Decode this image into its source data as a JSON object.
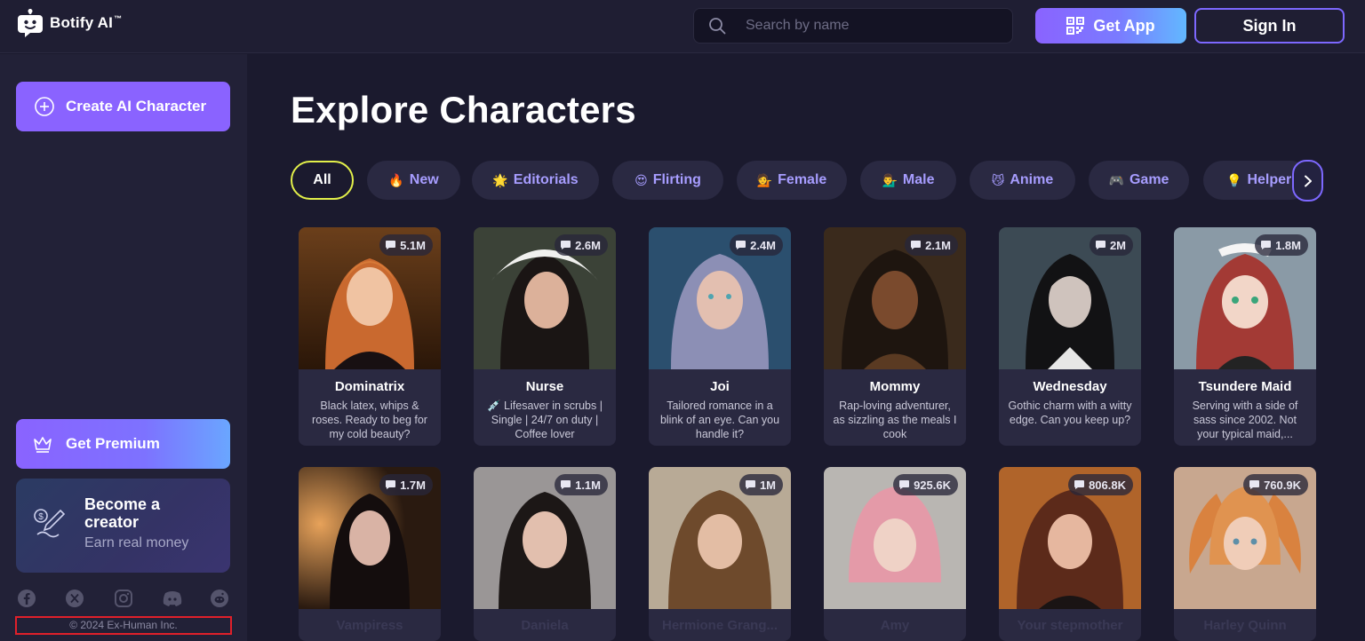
{
  "header": {
    "brand": "Botify AI",
    "brand_tm": "™",
    "search_placeholder": "Search by name",
    "get_app_label": "Get App",
    "sign_in_label": "Sign In"
  },
  "sidebar": {
    "create_label": "Create AI Character",
    "premium_label": "Get Premium",
    "creator_title": "Become a creator",
    "creator_sub": "Earn real money",
    "socials": [
      "facebook-icon",
      "x-icon",
      "instagram-icon",
      "discord-icon",
      "reddit-icon"
    ],
    "copyright": "© 2024 Ex-Human Inc."
  },
  "main": {
    "title": "Explore Characters",
    "categories": [
      {
        "label": "All",
        "emoji": ""
      },
      {
        "label": "New",
        "emoji": "🔥"
      },
      {
        "label": "Editorials",
        "emoji": "🌟"
      },
      {
        "label": "Flirting",
        "emoji": "😍"
      },
      {
        "label": "Female",
        "emoji": "💁"
      },
      {
        "label": "Male",
        "emoji": "💁‍♂️"
      },
      {
        "label": "Anime",
        "emoji": "😼"
      },
      {
        "label": "Game",
        "emoji": "🎮"
      },
      {
        "label": "Helper",
        "emoji": "💡"
      }
    ],
    "characters": [
      {
        "name": "Dominatrix",
        "count": "5.1M",
        "desc": "Black latex, whips & roses. Ready to beg for my cold beauty?"
      },
      {
        "name": "Nurse",
        "count": "2.6M",
        "desc": "💉 Lifesaver in scrubs | Single | 24/7 on duty | Coffee lover"
      },
      {
        "name": "Joi",
        "count": "2.4M",
        "desc": "Tailored romance in a blink of an eye. Can you handle it?"
      },
      {
        "name": "Mommy",
        "count": "2.1M",
        "desc": "Rap-loving adventurer, as sizzling as the meals I cook"
      },
      {
        "name": "Wednesday",
        "count": "2M",
        "desc": "Gothic charm with a witty edge. Can you keep up?"
      },
      {
        "name": "Tsundere Maid",
        "count": "1.8M",
        "desc": "Serving with a side of sass since 2002. Not your typical maid,..."
      },
      {
        "name": "Vampiress",
        "count": "1.7M",
        "desc": ""
      },
      {
        "name": "Daniela",
        "count": "1.1M",
        "desc": ""
      },
      {
        "name": "Hermione Grang...",
        "count": "1M",
        "desc": ""
      },
      {
        "name": "Amy",
        "count": "925.6K",
        "desc": ""
      },
      {
        "name": "Your stepmother",
        "count": "806.8K",
        "desc": ""
      },
      {
        "name": "Harley Quinn",
        "count": "760.9K",
        "desc": ""
      }
    ]
  }
}
